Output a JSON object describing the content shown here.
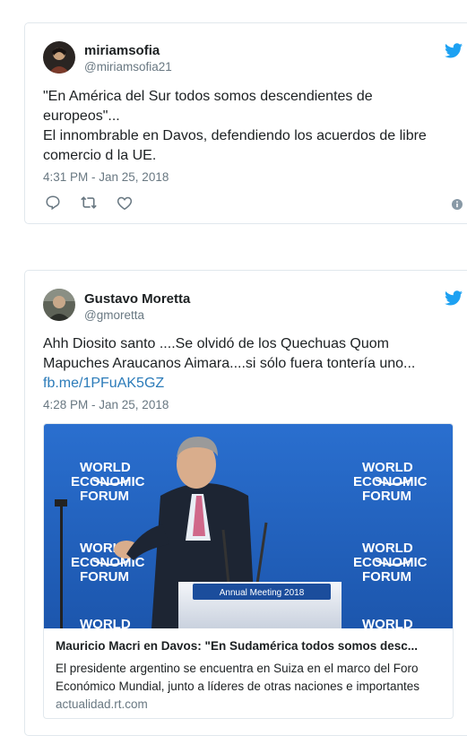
{
  "tweets": [
    {
      "name": "miriamsofia",
      "handle": "@miriamsofia21",
      "text_lines": [
        "\"En América del Sur todos somos descendientes de",
        "europeos\"...",
        "El innombrable en Davos, defendiendo los acuerdos de libre",
        "comercio d la UE."
      ],
      "timestamp": "4:31 PM - Jan 25, 2018",
      "icons": [
        "reply-icon",
        "retweet-icon",
        "like-icon",
        "info-icon",
        "twitter-bird-icon"
      ]
    },
    {
      "name": "Gustavo Moretta",
      "handle": "@gmoretta",
      "text_lines": [
        "Ahh Diosito  santo ....Se olvidó de los Quechuas Quom",
        "Mapuches  Araucanos Aimara....si  sólo fuera tontería uno..."
      ],
      "link": "fb.me/1PFuAK5GZ",
      "timestamp": "4:28 PM - Jan 25, 2018",
      "card": {
        "image_text": {
          "brand_line1": "WORLD",
          "brand_line2": "ECONOMIC",
          "brand_line3": "FORUM",
          "podium": "Annual Meeting 2018"
        },
        "title": "Mauricio Macri en Davos: \"En Sudamérica todos somos desc...",
        "description": "El presidente argentino se encuentra en Suiza en el marco del Foro Económico Mundial, junto a líderes de otras naciones e importantes",
        "domain": "actualidad.rt.com"
      }
    }
  ],
  "colors": {
    "twitter_blue": "#1da1f2",
    "text": "#1c2022",
    "muted": "#697882",
    "link": "#2b7bb9",
    "border": "#e1e8ed",
    "forum_blue": "#1a5fb4"
  }
}
